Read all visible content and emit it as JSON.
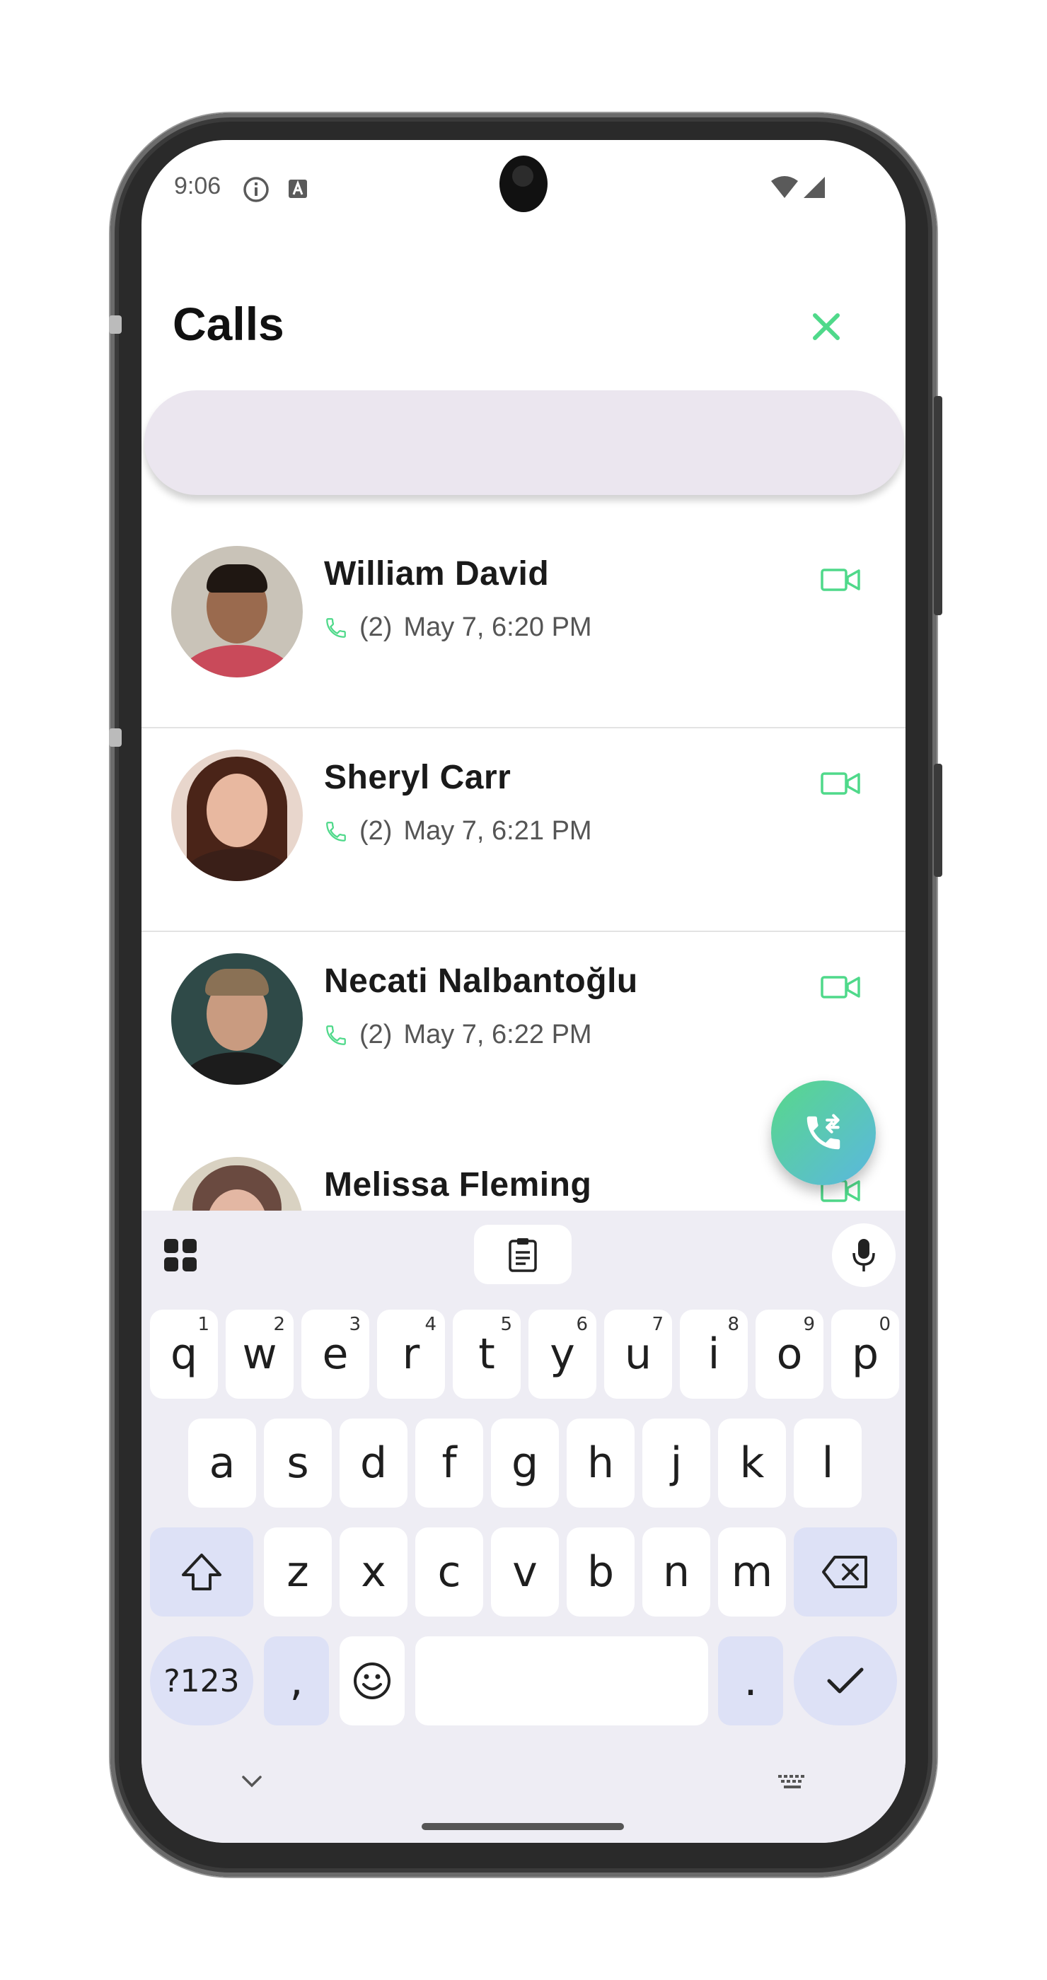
{
  "status_bar": {
    "time": "9:06",
    "icons": [
      "info-icon",
      "text-a-icon",
      "wifi-icon",
      "signal-icon"
    ]
  },
  "header": {
    "title": "Calls",
    "close_icon": "close-icon",
    "accent": "#4fd98a"
  },
  "search": {
    "value": "",
    "placeholder": ""
  },
  "calls": [
    {
      "name": "William David",
      "count": "(2)",
      "time": "May 7, 6:20 PM"
    },
    {
      "name": "Sheryl Carr",
      "count": "(2)",
      "time": "May 7, 6:21 PM"
    },
    {
      "name": "Necati Nalbantoğlu",
      "count": "(2)",
      "time": "May 7, 6:22 PM"
    },
    {
      "name": "Melissa Fleming",
      "count": "",
      "time": ""
    }
  ],
  "fab": {
    "icon": "call-forward-icon"
  },
  "keyboard": {
    "row1": [
      {
        "k": "q",
        "n": "1"
      },
      {
        "k": "w",
        "n": "2"
      },
      {
        "k": "e",
        "n": "3"
      },
      {
        "k": "r",
        "n": "4"
      },
      {
        "k": "t",
        "n": "5"
      },
      {
        "k": "y",
        "n": "6"
      },
      {
        "k": "u",
        "n": "7"
      },
      {
        "k": "i",
        "n": "8"
      },
      {
        "k": "o",
        "n": "9"
      },
      {
        "k": "p",
        "n": "0"
      }
    ],
    "row2": [
      "a",
      "s",
      "d",
      "f",
      "g",
      "h",
      "j",
      "k",
      "l"
    ],
    "row3": [
      "z",
      "x",
      "c",
      "v",
      "b",
      "n",
      "m"
    ],
    "symbols_label": "?123",
    "comma_label": ",",
    "period_label": ".",
    "space_label": ""
  }
}
